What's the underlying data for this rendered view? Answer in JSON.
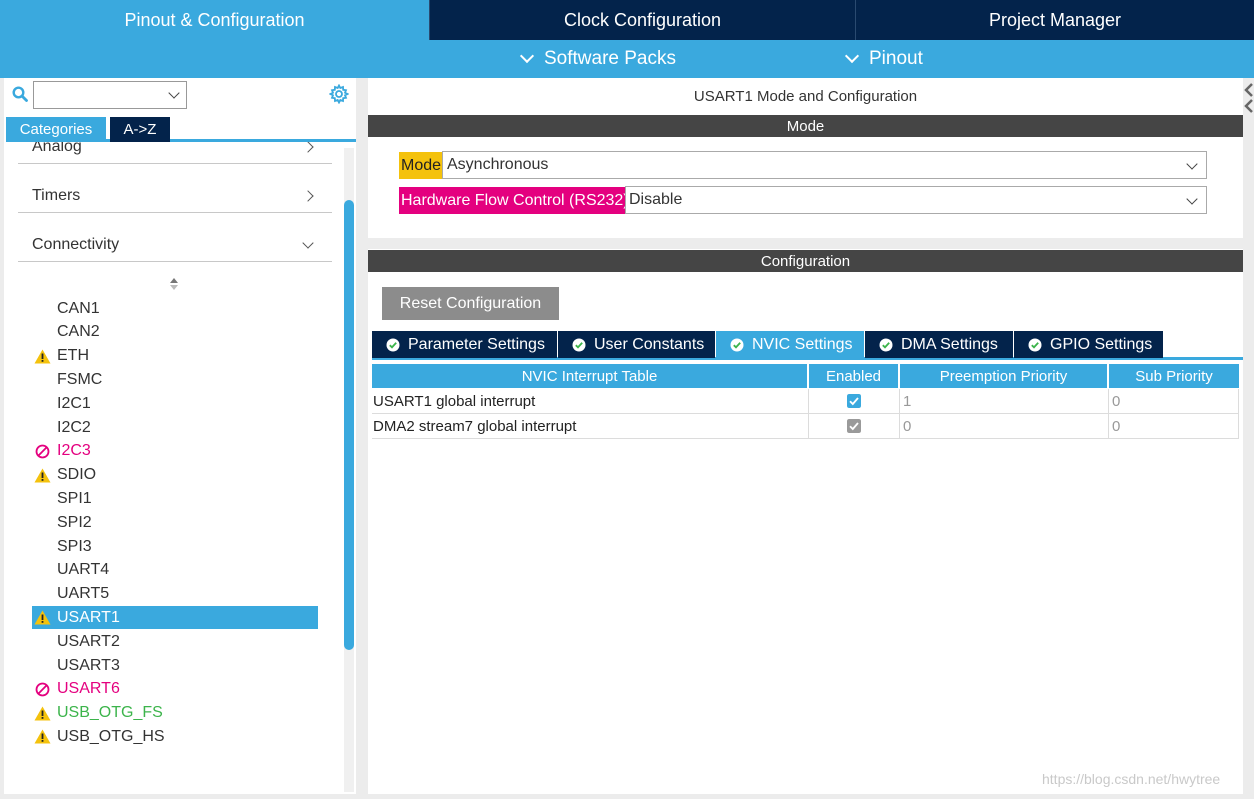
{
  "top_tabs": [
    {
      "label": "Pinout & Configuration"
    },
    {
      "label": "Clock Configuration"
    },
    {
      "label": "Project Manager"
    }
  ],
  "sub_menu": [
    {
      "label": "Software Packs"
    },
    {
      "label": "Pinout"
    }
  ],
  "left": {
    "search_value": "",
    "view_tabs": [
      "Categories",
      "A->Z"
    ],
    "categories": [
      {
        "label": "Analog"
      },
      {
        "label": "Timers"
      },
      {
        "label": "Connectivity"
      }
    ],
    "peripherals": [
      {
        "label": "CAN1",
        "status": "none"
      },
      {
        "label": "CAN2",
        "status": "none"
      },
      {
        "label": "ETH",
        "status": "warning"
      },
      {
        "label": "FSMC",
        "status": "none"
      },
      {
        "label": "I2C1",
        "status": "none"
      },
      {
        "label": "I2C2",
        "status": "none"
      },
      {
        "label": "I2C3",
        "status": "blocked"
      },
      {
        "label": "SDIO",
        "status": "warning"
      },
      {
        "label": "SPI1",
        "status": "none"
      },
      {
        "label": "SPI2",
        "status": "none"
      },
      {
        "label": "SPI3",
        "status": "none"
      },
      {
        "label": "UART4",
        "status": "none"
      },
      {
        "label": "UART5",
        "status": "none"
      },
      {
        "label": "USART1",
        "status": "warning-selected"
      },
      {
        "label": "USART2",
        "status": "none"
      },
      {
        "label": "USART3",
        "status": "none"
      },
      {
        "label": "USART6",
        "status": "blocked"
      },
      {
        "label": "USB_OTG_FS",
        "status": "warning-green"
      },
      {
        "label": "USB_OTG_HS",
        "status": "warning"
      }
    ]
  },
  "mode_panel": {
    "title": "USART1 Mode and Configuration",
    "section": "Mode",
    "mode_label": "Mode",
    "mode_value": "Asynchronous",
    "hw_label": "Hardware Flow Control (RS232)",
    "hw_value": "Disable"
  },
  "config_panel": {
    "section": "Configuration",
    "reset_label": "Reset Configuration",
    "tabs": [
      {
        "label": "Parameter Settings"
      },
      {
        "label": "User Constants"
      },
      {
        "label": "NVIC Settings"
      },
      {
        "label": "DMA Settings"
      },
      {
        "label": "GPIO Settings"
      }
    ],
    "table": {
      "headers": [
        "NVIC Interrupt Table",
        "Enabled",
        "Preemption Priority",
        "Sub Priority"
      ],
      "rows": [
        {
          "name": "USART1 global interrupt",
          "enabled": true,
          "preemption": "1",
          "sub": "0"
        },
        {
          "name": "DMA2 stream7 global interrupt",
          "enabled": true,
          "preemption": "0",
          "sub": "0"
        }
      ]
    }
  },
  "watermark": "https://blog.csdn.net/hwytree",
  "colors": {
    "accent": "#3aa9de",
    "navy": "#03234b",
    "warning": "#f4c20d",
    "blocked": "#e4007f",
    "ok": "#3cb44b"
  }
}
